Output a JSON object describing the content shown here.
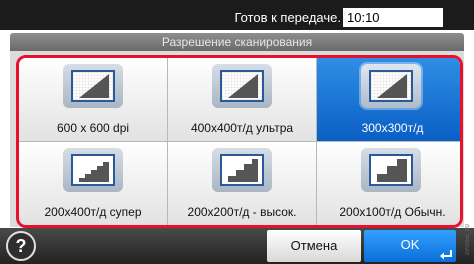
{
  "status": {
    "message": "Готов к передаче.",
    "time": "10:10"
  },
  "title": "Разрешение сканирования",
  "options": [
    {
      "label": "600 x 600 dpi",
      "icon": "resolution-high-icon",
      "selected": false
    },
    {
      "label": "400x400т/д ультра",
      "icon": "resolution-high-icon",
      "selected": false
    },
    {
      "label": "300x300т/д",
      "icon": "resolution-high-icon",
      "selected": true
    },
    {
      "label": "200x400т/д супер",
      "icon": "resolution-low-icon",
      "selected": false
    },
    {
      "label": "200x200т/д - высок.",
      "icon": "resolution-low-icon",
      "selected": false
    },
    {
      "label": "200x100т/д Обычн.",
      "icon": "resolution-low-icon",
      "selected": false
    }
  ],
  "footer": {
    "help": "?",
    "cancel": "Отмена",
    "ok": "OK"
  },
  "side_code": "2P0055_00",
  "colors": {
    "selected": "#0a6fd8",
    "highlight_border": "#e8102a",
    "status_bar": "#1b1b1b"
  }
}
